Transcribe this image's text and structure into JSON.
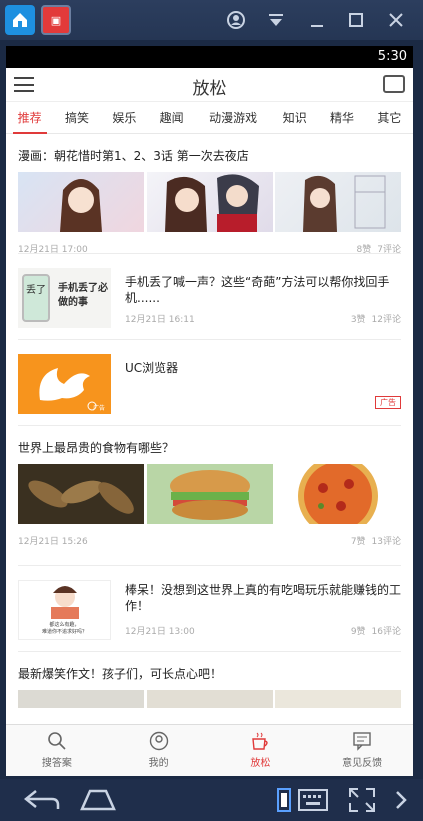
{
  "phone": {
    "clock": "5:30"
  },
  "appbar": {
    "title": "放松"
  },
  "tabs": [
    {
      "label": "推荐",
      "active": true
    },
    {
      "label": "搞笑"
    },
    {
      "label": "娱乐"
    },
    {
      "label": "趣闻"
    },
    {
      "label": "动漫游戏"
    },
    {
      "label": "知识"
    },
    {
      "label": "精华"
    },
    {
      "label": "其它"
    }
  ],
  "articles": [
    {
      "title": "漫画：朝花惜时第1、2、3话 第一次去夜店",
      "date": "12月21日 17:00",
      "likes": "8赞",
      "comments": "7评论"
    },
    {
      "title": "手机丢了喊一声？这些“奇葩”方法可以帮你找回手机......",
      "date": "12月21日 16:11",
      "likes": "3赞",
      "comments": "12评论",
      "thumb_text_top": "丢了",
      "thumb_text_main": "手机丢了必做的事"
    },
    {
      "title": "UC浏览器",
      "ad_tag": "广告",
      "ad_badge": "广告"
    },
    {
      "title": "世界上最昂贵的食物有哪些？",
      "date": "12月21日 15:26",
      "likes": "7赞",
      "comments": "13评论"
    },
    {
      "title": "棒呆！没想到这世界上真的有吃喝玩乐就能赚钱的工作！",
      "date": "12月21日 13:00",
      "likes": "9赞",
      "comments": "16评论",
      "thumb_caption": "都这么有趣，\n难道你不追求好吗？"
    },
    {
      "title": "最新爆笑作文！孩子们，可长点心吧！"
    }
  ],
  "bottomnav": [
    {
      "label": "搜答案"
    },
    {
      "label": "我的"
    },
    {
      "label": "放松",
      "active": true
    },
    {
      "label": "意见反馈"
    }
  ]
}
